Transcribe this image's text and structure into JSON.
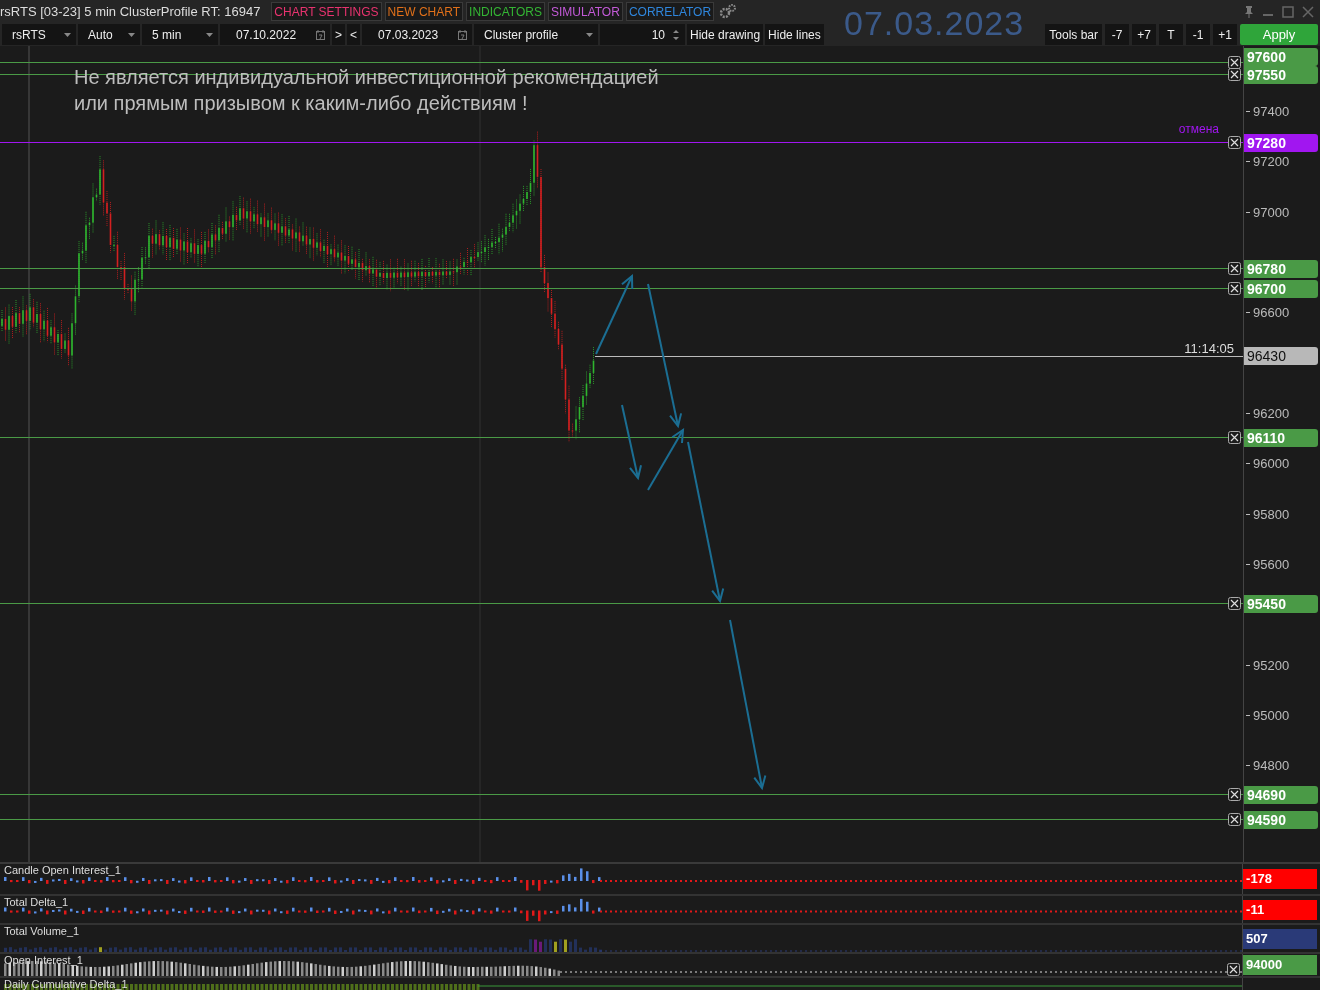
{
  "window": {
    "title": "rsRTS [03-23] 5 min ClusterProfile RT: 16947"
  },
  "menu": [
    {
      "label": "CHART SETTINGS",
      "color": "#e8336f"
    },
    {
      "label": "NEW CHART",
      "color": "#e0701a"
    },
    {
      "label": "INDICATORS",
      "color": "#34b534"
    },
    {
      "label": "SIMULATOR",
      "color": "#c35ad8"
    },
    {
      "label": "CORRELATOR",
      "color": "#2f86dc"
    }
  ],
  "date_display": "07.03.2023",
  "toolbar": [
    {
      "kind": "dropdown",
      "value": "rsRTS"
    },
    {
      "kind": "dropdown",
      "value": "Auto"
    },
    {
      "kind": "dropdown",
      "value": "5 min"
    },
    {
      "kind": "date",
      "value": "07.10.2022"
    },
    {
      "kind": "button",
      "label": ">"
    },
    {
      "kind": "button",
      "label": "<"
    },
    {
      "kind": "date",
      "value": "07.03.2023"
    },
    {
      "kind": "dropdown",
      "value": "Cluster profile"
    },
    {
      "kind": "spinner",
      "value": "10"
    },
    {
      "kind": "button",
      "label": "Hide drawing"
    },
    {
      "kind": "button",
      "label": "Hide lines"
    }
  ],
  "tools": [
    "Tools bar",
    "-7",
    "+7",
    "T",
    "-1",
    "+1"
  ],
  "apply": "Apply",
  "chart": {
    "note": "Не является индивидуальной инвестиционной рекомендацией\nили прямым призывом к каким-либо действиям !",
    "axis_ticks": [
      "97400",
      "97200",
      "97000",
      "96600",
      "96200",
      "96000",
      "95800",
      "95600",
      "95200",
      "95000",
      "94800"
    ],
    "levels": [
      {
        "price": "97600",
        "color": "#4a9a46"
      },
      {
        "price": "97550",
        "color": "#4a9a46"
      },
      {
        "price": "97280",
        "color": "#a116f0",
        "label": "отмена"
      },
      {
        "price": "96780",
        "color": "#4a9a46"
      },
      {
        "price": "96700",
        "color": "#4a9a46"
      },
      {
        "price": "96110",
        "color": "#4a9a46"
      },
      {
        "price": "95450",
        "color": "#4a9a46"
      },
      {
        "price": "94690",
        "color": "#4a9a46"
      },
      {
        "price": "94590",
        "color": "#4a9a46"
      }
    ],
    "current": {
      "price": "96430",
      "time": "11:14:05"
    }
  },
  "indicators": [
    {
      "name": "Candle Open Interest_1",
      "kind": "delta",
      "value": "-178",
      "color": "#ff0000"
    },
    {
      "name": "Total Delta_1",
      "kind": "delta",
      "value": "-11",
      "color": "#ff0000"
    },
    {
      "name": "Total Volume_1",
      "kind": "volume",
      "value": "507",
      "color": "#2a3a78"
    },
    {
      "name": "Open Interest_1",
      "kind": "oi",
      "value": "94000",
      "color": "#4a9a46"
    },
    {
      "name": "Daily Cumulative Delta_1",
      "kind": "cumulative"
    }
  ]
}
